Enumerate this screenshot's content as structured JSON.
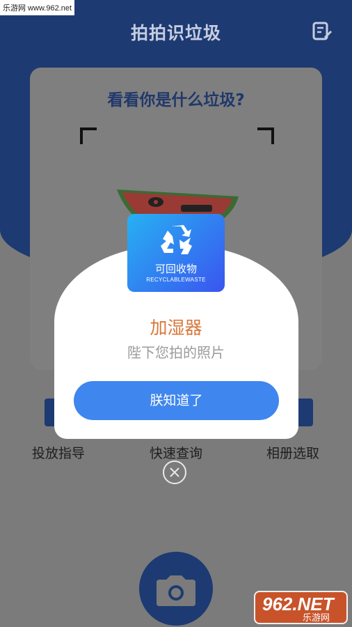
{
  "watermark": "乐游网 www.962.net",
  "header": {
    "title": "拍拍识垃圾",
    "note_icon": "note-edit-icon"
  },
  "scan": {
    "title": "看看你是什么垃圾?"
  },
  "nav": [
    {
      "label": "投放指导",
      "icon": "guide-icon"
    },
    {
      "label": "快速查询",
      "icon": "search-icon"
    },
    {
      "label": "相册选取",
      "icon": "album-icon"
    }
  ],
  "result": {
    "category": "可回收物",
    "category_en": "RECYCLABLEWASTE",
    "item_name": "加湿器",
    "subtitle": "陛下您拍的照片",
    "confirm_button": "朕知道了",
    "close_icon": "close-icon"
  },
  "camera": {
    "icon": "camera-icon"
  },
  "logo": {
    "big": "962.NET",
    "small": "乐游网"
  },
  "colors": {
    "primary": "#1d3a72",
    "accent": "#3f86ee",
    "badge_start": "#27b1f2",
    "badge_end": "#3a55f0",
    "item_name": "#d8773a"
  }
}
